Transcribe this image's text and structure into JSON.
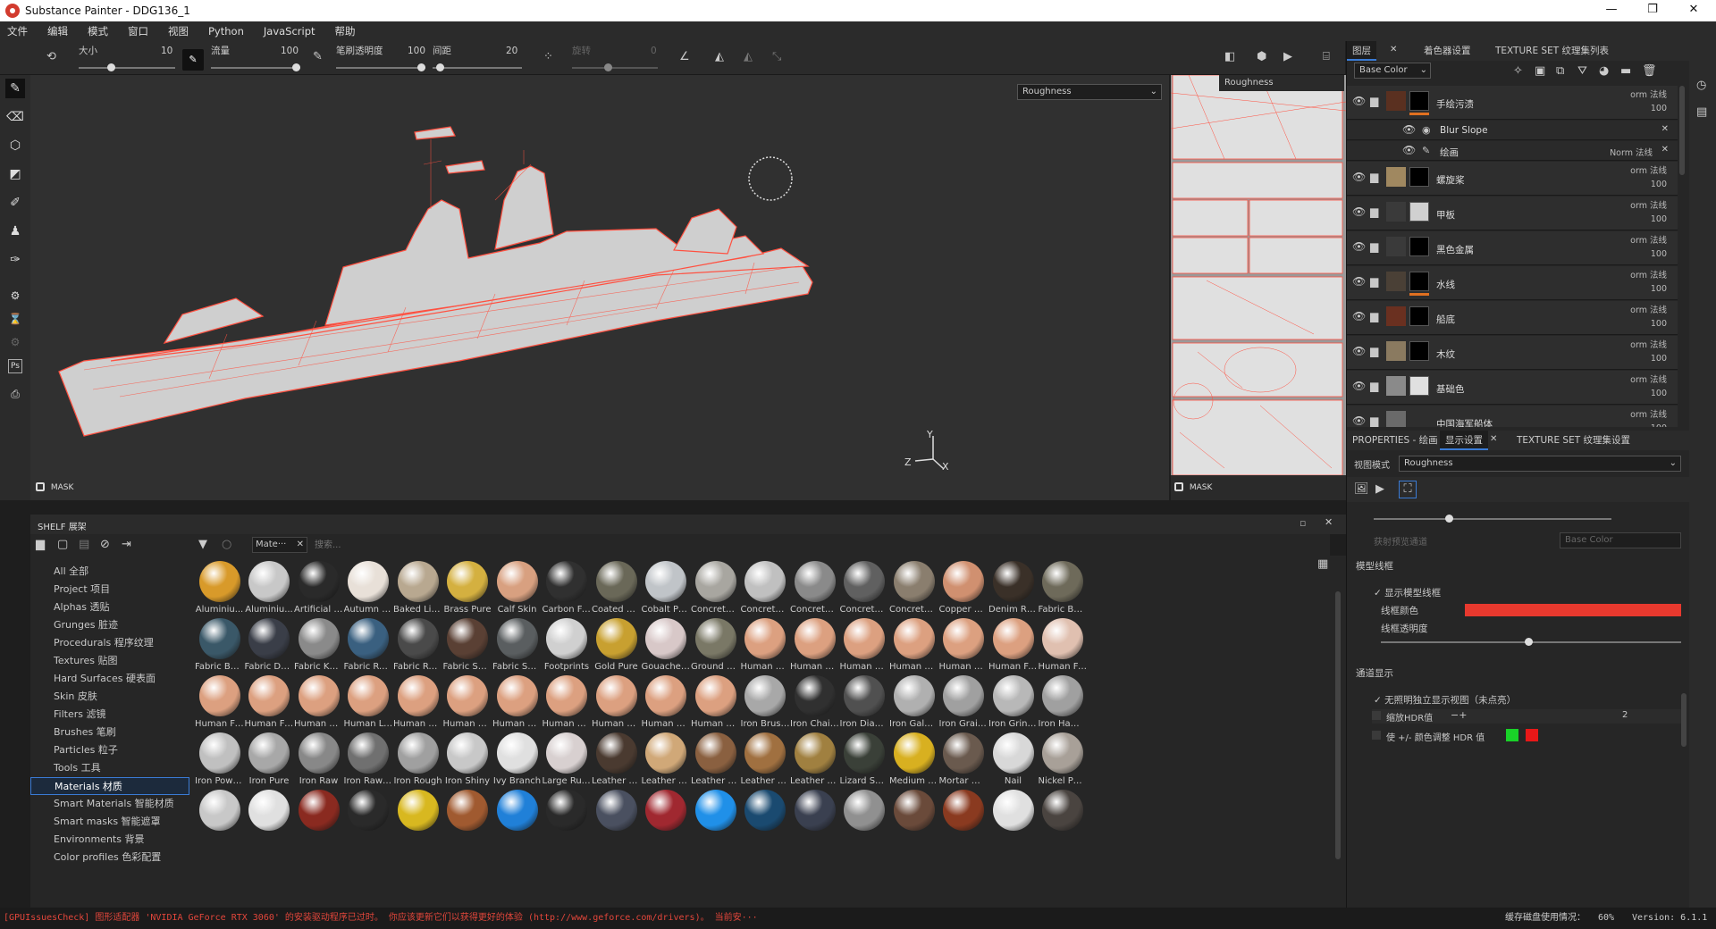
{
  "titlebar": {
    "title": "Substance Painter - DDG136_1",
    "minimize": "—",
    "maximize": "❐",
    "close": "✕"
  },
  "menu": [
    "文件",
    "编辑",
    "模式",
    "窗口",
    "视图",
    "Python",
    "JavaScript",
    "帮助"
  ],
  "toolbar": {
    "size_label": "大小",
    "size_value": "10",
    "flow_label": "流量",
    "flow_value": "100",
    "stroke_opacity_label": "笔刷透明度",
    "stroke_opacity_value": "100",
    "spacing_label": "间距",
    "spacing_value": "20",
    "angle_label": "旋转",
    "angle_value": "0",
    "size_fill": 0.1,
    "flow_fill": 1.0,
    "opacity_fill": 1.0,
    "spacing_fill": 0.2
  },
  "viewport": {
    "channel_select": "Roughness",
    "mask_label": "MASK",
    "axis_y": "Y",
    "axis_z": "Z",
    "axis_x": "X"
  },
  "uvview": {
    "channel_select": "Roughness",
    "mask_label": "MASK"
  },
  "shelf": {
    "title": "SHELF 展架",
    "filter_chip": "Mate···",
    "search_placeholder": "搜索...",
    "categories": [
      "All 全部",
      "Project 项目",
      "Alphas 透贴",
      "Grunges 脏迹",
      "Procedurals 程序纹理",
      "Textures 贴图",
      "Hard Surfaces 硬表面",
      "Skin 皮肤",
      "Filters 滤镜",
      "Brushes 笔刷",
      "Particles 粒子",
      "Tools 工具",
      "Materials 材质",
      "Smart Materials 智能材质",
      "Smart masks 智能遮罩",
      "Environments 背景",
      "Color profiles 色彩配置"
    ],
    "selected_category": "Materials 材质",
    "materials": [
      [
        "Aluminiu...",
        "#d89a2a"
      ],
      [
        "Aluminiu...",
        "#c8c8c8"
      ],
      [
        "Artificial L...",
        "#2a2a2a"
      ],
      [
        "Autumn L...",
        "#e8e0d8"
      ],
      [
        "Baked Lig...",
        "#b8a890"
      ],
      [
        "Brass Pure",
        "#d4b040"
      ],
      [
        "Calf Skin",
        "#d8a080"
      ],
      [
        "Carbon Fi...",
        "#303030"
      ],
      [
        "Coated M...",
        "#6a6858"
      ],
      [
        "Cobalt Pure",
        "#c0c4c8"
      ],
      [
        "Concrete ...",
        "#a8a6a0"
      ],
      [
        "Concrete ...",
        "#c0c0c0"
      ],
      [
        "Concrete ...",
        "#8a8a8a"
      ],
      [
        "Concrete ...",
        "#606060"
      ],
      [
        "Concrete ...",
        "#8a7e6e"
      ],
      [
        "Copper Pure",
        "#d09070"
      ],
      [
        "Denim Rivet",
        "#3a3028"
      ],
      [
        "Fabric Ba...",
        "#6e6a5a"
      ],
      [
        "Fabric Bas...",
        "#3a5868"
      ],
      [
        "Fabric De...",
        "#3a3e48"
      ],
      [
        "Fabric Knit...",
        "#8a8a8a"
      ],
      [
        "Fabric Rou...",
        "#3a6080"
      ],
      [
        "Fabric Rou...",
        "#4a4a4a"
      ],
      [
        "Fabric Soft...",
        "#5a4034"
      ],
      [
        "Fabric Suit...",
        "#5a5e60"
      ],
      [
        "Footprints",
        "#d0d0d0"
      ],
      [
        "Gold Pure",
        "#c8a030"
      ],
      [
        "Gouache P...",
        "#d8c8c8"
      ],
      [
        "Ground Gr...",
        "#7a7866"
      ],
      [
        "Human Ba...",
        "#dca080"
      ],
      [
        "Human Be...",
        "#dca080"
      ],
      [
        "Human Bu...",
        "#dca080"
      ],
      [
        "Human Ch...",
        "#dca080"
      ],
      [
        "Human Ey...",
        "#dca080"
      ],
      [
        "Human Fa...",
        "#dca080"
      ],
      [
        "Human Fe...",
        "#e0c0b0"
      ],
      [
        "Human Fo...",
        "#dca080"
      ],
      [
        "Human Fo...",
        "#dca080"
      ],
      [
        "Human H...",
        "#dca080"
      ],
      [
        "Human Le...",
        "#dca080"
      ],
      [
        "Human M...",
        "#dca080"
      ],
      [
        "Human N...",
        "#dca080"
      ],
      [
        "Human N...",
        "#dca080"
      ],
      [
        "Human N...",
        "#dca080"
      ],
      [
        "Human N...",
        "#dca080"
      ],
      [
        "Human Sh...",
        "#dca080"
      ],
      [
        "Human W...",
        "#dca080"
      ],
      [
        "Iron Brush...",
        "#a8a8a8"
      ],
      [
        "Iron Chain...",
        "#303030"
      ],
      [
        "Iron Diam...",
        "#505050"
      ],
      [
        "Iron Galva...",
        "#b0b0b0"
      ],
      [
        "Iron Grainy",
        "#a0a0a0"
      ],
      [
        "Iron Grinded",
        "#b8b8b8"
      ],
      [
        "Iron Ham...",
        "#a0a0a0"
      ],
      [
        "Iron Powd...",
        "#c0c0c0"
      ],
      [
        "Iron Pure",
        "#a8a8a8"
      ],
      [
        "Iron Raw",
        "#888888"
      ],
      [
        "Iron Raw ...",
        "#707070"
      ],
      [
        "Iron Rough",
        "#a0a0a0"
      ],
      [
        "Iron Shiny",
        "#c8c8c8"
      ],
      [
        "Ivy Branch",
        "#e0e0e0"
      ],
      [
        "Large Rus...",
        "#d8d0d0"
      ],
      [
        "Leather bag",
        "#4a3a30"
      ],
      [
        "Leather Br...",
        "#d0a878"
      ],
      [
        "Leather M...",
        "#8a6040"
      ],
      [
        "Leather R...",
        "#a07040"
      ],
      [
        "Leather S...",
        "#a08040"
      ],
      [
        "Lizard Sca...",
        "#3a4038"
      ],
      [
        "Medium A...",
        "#d8b020"
      ],
      [
        "Mortar Wall",
        "#6a5a4e"
      ],
      [
        "Nail",
        "#d8d8d8"
      ],
      [
        "Nickel Pure",
        "#a8a098"
      ],
      [
        "",
        "#c8c8c8"
      ],
      [
        "",
        "#e0e0e0"
      ],
      [
        "",
        "#8a2a20"
      ],
      [
        "",
        "#2a2a2a"
      ],
      [
        "",
        "#d8b820"
      ],
      [
        "",
        "#a05a30"
      ],
      [
        "",
        "#2080d8"
      ],
      [
        "",
        "#2a2a2a"
      ],
      [
        "",
        "#4a5060"
      ],
      [
        "",
        "#a02830"
      ],
      [
        "",
        "#2090e8"
      ],
      [
        "",
        "#1a4a70"
      ],
      [
        "",
        "#3a4050"
      ],
      [
        "",
        "#909090"
      ],
      [
        "",
        "#6a4a3a"
      ],
      [
        "",
        "#8a3a20"
      ],
      [
        "",
        "#e0e0e0"
      ],
      [
        "",
        "#4a4440"
      ]
    ]
  },
  "layers_panel": {
    "tabs": [
      "图层",
      "着色器设置",
      "TEXTURE SET 纹理集列表"
    ],
    "channel_select": "Base Color",
    "layers": [
      {
        "name": "手绘污渍",
        "blend": "orm 法线",
        "opacity": "100",
        "thumb": "#5a3020",
        "mask": "#000000",
        "bar": "#e07020"
      },
      {
        "name": "Blur Slope",
        "sub": true,
        "blend": "",
        "opacity": ""
      },
      {
        "name": "绘画",
        "sub": true,
        "blend": "Norm 法线",
        "opacity": "100"
      },
      {
        "name": "螺旋桨",
        "blend": "orm 法线",
        "opacity": "100",
        "thumb": "#a08860",
        "mask": "#000000",
        "bar": ""
      },
      {
        "name": "甲板",
        "blend": "orm 法线",
        "opacity": "100",
        "thumb": "#3a3a3a",
        "mask": "#d0d0d0",
        "bar": ""
      },
      {
        "name": "黑色金属",
        "blend": "orm 法线",
        "opacity": "100",
        "thumb": "#3a3a3a",
        "mask": "#000000",
        "bar": ""
      },
      {
        "name": "水线",
        "blend": "orm 法线",
        "opacity": "100",
        "thumb": "#4a4036",
        "mask": "#000000",
        "bar": "#e07020"
      },
      {
        "name": "船底",
        "blend": "orm 法线",
        "opacity": "100",
        "thumb": "#6a3020",
        "mask": "#000000",
        "bar": ""
      },
      {
        "name": "木纹",
        "blend": "orm 法线",
        "opacity": "100",
        "thumb": "#8a7a60",
        "mask": "#000000",
        "bar": ""
      },
      {
        "name": "基础色",
        "blend": "orm 法线",
        "opacity": "100",
        "thumb": "#8a8a8a",
        "mask": "#e0e0e0",
        "bar": ""
      },
      {
        "name": "中国海军船体",
        "blend": "orm 法线",
        "opacity": "100",
        "thumb": "#6a6a6a",
        "mask": "",
        "bar": ""
      }
    ]
  },
  "props_panel": {
    "tabs": [
      "PROPERTIES - 绘画",
      "显示设置",
      "TEXTURE SET 纹理集设置"
    ],
    "view_mode_label": "视图模式",
    "view_mode_value": "Roughness",
    "channel_label": "获射预览通道",
    "channel_value": "Base Color",
    "wireframe_section": "模型线框",
    "show_wireframe": "显示模型线框",
    "wire_color_label": "线框颜色",
    "wire_opacity_label": "线框透明度",
    "channel_section": "通道显示",
    "isolate_label": "无照明独立显示视图（未点亮）",
    "hdr_scale_label": "缩放HDR值",
    "hdr_value": "2",
    "hdr_adjust_label": "使 +/- 颜色调整 HDR 值",
    "wire_color": "#e8392e",
    "hdr_plus_color": "#19d228",
    "hdr_minus_color": "#e81818",
    "top_slider_fill": 0.3,
    "wire_opacity_fill": 0.48
  },
  "status": {
    "message": "[GPUIssuesCheck] 图形适配器 'NVIDIA GeForce RTX 3060' 的安装驱动程序已过时。 你应该更新它们以获得更好的体验 (http://www.geforce.com/drivers)。 当前安···",
    "cache": "缓存磁盘使用情况：",
    "cache_value": "60%",
    "version": "Version: 6.1.1"
  }
}
